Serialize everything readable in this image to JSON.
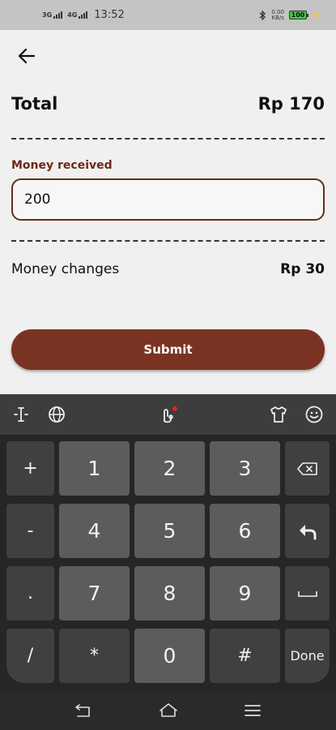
{
  "status_bar": {
    "network1": "3G",
    "network2": "4G",
    "time": "13:52",
    "speed_value": "0.00",
    "speed_unit": "KB/s",
    "battery": "100"
  },
  "header": {
    "back_icon": "arrow-left-icon"
  },
  "summary": {
    "total_label": "Total",
    "total_value": "Rp 170",
    "money_received_label": "Money received",
    "money_received_value": "200",
    "changes_label": "Money changes",
    "changes_value": "Rp 30"
  },
  "actions": {
    "submit_label": "Submit"
  },
  "keyboard": {
    "toolbar_icons": [
      "text-cursor-icon",
      "globe-icon",
      "swipe-gesture-icon",
      "theme-shirt-icon",
      "emoji-icon"
    ],
    "keys": {
      "plus": "+",
      "one": "1",
      "two": "2",
      "three": "3",
      "minus": "-",
      "four": "4",
      "five": "5",
      "six": "6",
      "dot": ".",
      "seven": "7",
      "eight": "8",
      "nine": "9",
      "slash": "/",
      "star": "*",
      "zero": "0",
      "hash": "#",
      "done": "Done"
    }
  },
  "navigation": {
    "icons": [
      "back-icon",
      "home-icon",
      "menu-icon"
    ]
  },
  "colors": {
    "accent": "#7a3322",
    "label": "#6b2a1a",
    "background": "#f0f0f0",
    "keyboard": "#262626"
  }
}
